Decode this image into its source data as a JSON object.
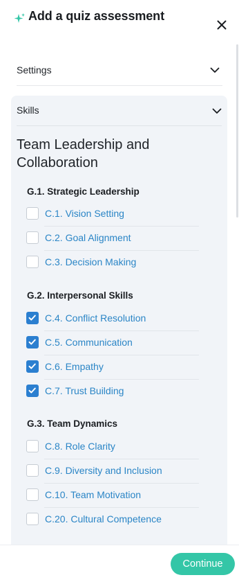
{
  "header": {
    "title": "Add a quiz assessment",
    "sparkle_icon": "sparkle-icon",
    "close_icon": "close-icon",
    "accent_color": "#34c6a7"
  },
  "settings": {
    "label": "Settings"
  },
  "skills": {
    "label": "Skills",
    "section_title": "Team Leadership and Collaboration",
    "groups": [
      {
        "title": "G.1. Strategic Leadership",
        "items": [
          {
            "label": "C.1. Vision Setting",
            "checked": false
          },
          {
            "label": "C.2. Goal Alignment",
            "checked": false
          },
          {
            "label": "C.3. Decision Making",
            "checked": false
          }
        ]
      },
      {
        "title": "G.2. Interpersonal Skills",
        "items": [
          {
            "label": "C.4. Conflict Resolution",
            "checked": true
          },
          {
            "label": "C.5. Communication",
            "checked": true
          },
          {
            "label": "C.6. Empathy",
            "checked": true
          },
          {
            "label": "C.7. Trust Building",
            "checked": true
          }
        ]
      },
      {
        "title": "G.3. Team Dynamics",
        "items": [
          {
            "label": "C.8. Role Clarity",
            "checked": false
          },
          {
            "label": "C.9. Diversity and Inclusion",
            "checked": false
          },
          {
            "label": "C.10. Team Motivation",
            "checked": false
          },
          {
            "label": "C.20. Cultural Competence",
            "checked": false
          }
        ]
      }
    ]
  },
  "footer": {
    "continue_label": "Continue"
  }
}
